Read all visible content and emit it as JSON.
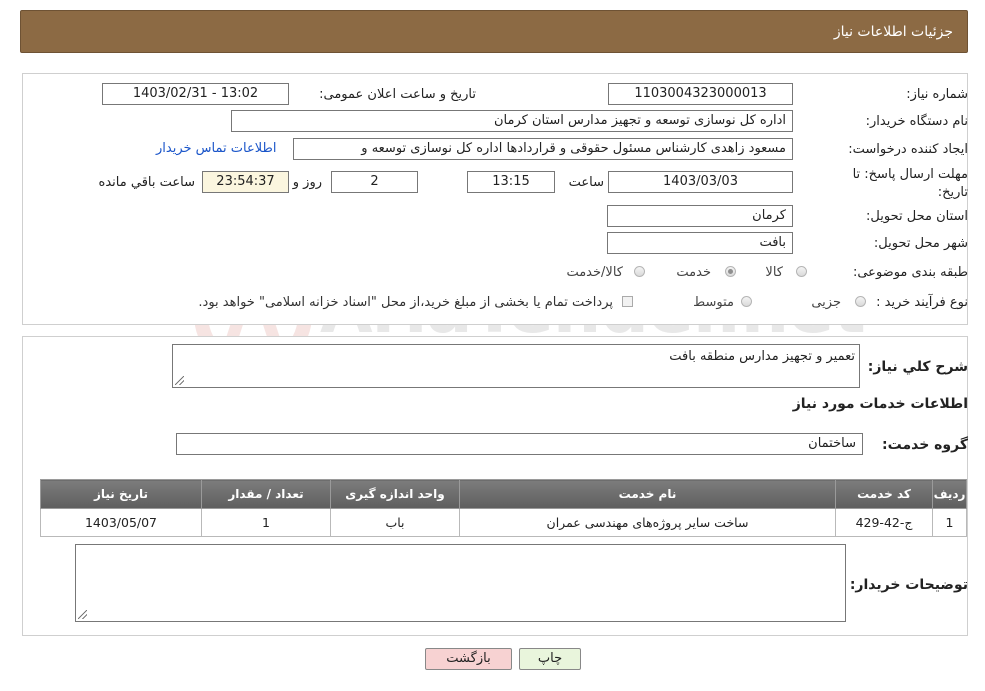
{
  "header": {
    "title": "جزئیات اطلاعات نیاز"
  },
  "form": {
    "need_number_label": "شماره نیاز:",
    "need_number": "1103004323000013",
    "announce_label": "تاریخ و ساعت اعلان عمومی:",
    "announce_value": "1403/02/31 - 13:02",
    "buyer_org_label": "نام دستگاه خریدار:",
    "buyer_org": "اداره کل نوسازی  توسعه و تجهیز مدارس استان کرمان",
    "creator_label": "ایجاد کننده درخواست:",
    "creator": "مسعود زاهدی کارشناس مسئول حقوقی و قراردادها اداره کل نوسازی  توسعه و",
    "contact_link": "اطلاعات تماس خریدار",
    "deadline_label_1": "مهلت ارسال پاسخ: تا",
    "deadline_label_2": "تاریخ:",
    "deadline_date": "1403/03/03",
    "time_label": "ساعت",
    "deadline_time": "13:15",
    "days_value": "2",
    "days_label": "روز و",
    "remaining_value": "23:54:37",
    "remaining_label": "ساعت باقي مانده",
    "province_label": "استان محل تحویل:",
    "province": "کرمان",
    "city_label": "شهر محل تحویل:",
    "city": "بافت",
    "category_label": "طبقه بندی موضوعی:",
    "category_options": [
      "کالا",
      "خدمت",
      "کالا/خدمت"
    ],
    "category_selected": "خدمت",
    "process_label": "نوع فرآیند خرید :",
    "process_options": [
      "جزیی",
      "متوسط"
    ],
    "payment_note": "پرداخت تمام یا بخشی از مبلغ خرید،از محل \"اسناد خزانه اسلامی\" خواهد بود."
  },
  "details": {
    "summary_label": "شرح کلي نياز:",
    "summary": "تعمیر و تجهیز مدارس منطقه بافت",
    "services_title": "اطلاعات خدمات مورد نیاز",
    "service_group_label": "گروه خدمت:",
    "service_group": "ساختمان",
    "table": {
      "headers": [
        "ردیف",
        "کد خدمت",
        "نام خدمت",
        "واحد اندازه گیری",
        "تعداد / مقدار",
        "تاریخ نیاز"
      ],
      "rows": [
        [
          "1",
          "ج-42-429",
          "ساخت سایر پروژه‌های مهندسی عمران",
          "باب",
          "1",
          "1403/05/07"
        ]
      ]
    },
    "buyer_notes_label": "توضیحات خریدار:",
    "buyer_notes": ""
  },
  "buttons": {
    "print": "چاپ",
    "back": "بازگشت"
  },
  "watermark": {
    "text": "AriaTender.net",
    "icon": "aria-logo-icon"
  },
  "colors": {
    "header_bg": "#8c6a44",
    "link": "#1a55c9",
    "back_button": "#f7d2d2",
    "print_button": "#e9f5dc"
  }
}
